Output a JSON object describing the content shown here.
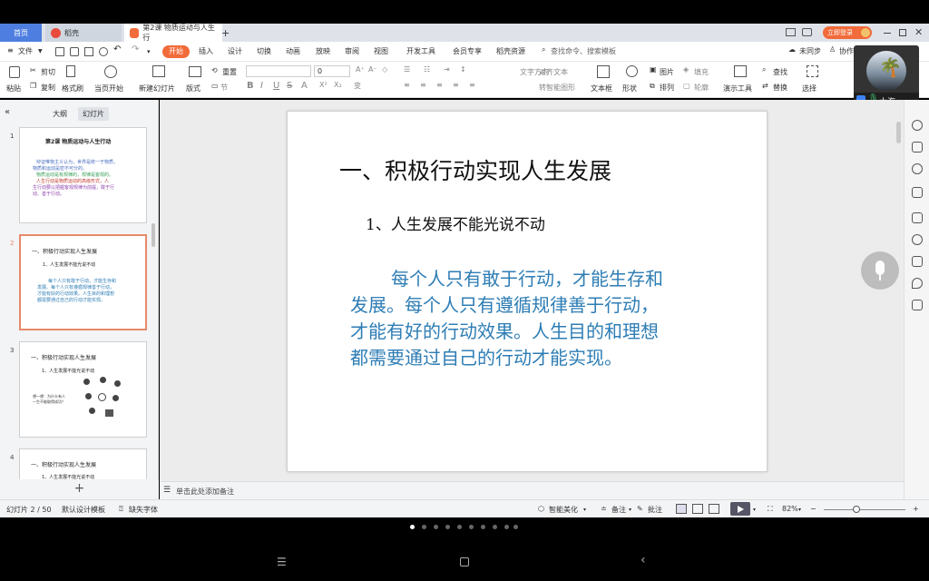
{
  "tabs": {
    "home": "首页",
    "daoke": "稻壳",
    "doc": "第2课 物质运动与人生行",
    "add": "+"
  },
  "login": {
    "label": "立即登录"
  },
  "menu": {
    "file": "文件",
    "start": "开始",
    "items": [
      "插入",
      "设计",
      "切换",
      "动画",
      "放映",
      "审阅",
      "视图",
      "开发工具",
      "会员专享",
      "稻壳资源"
    ],
    "search_placeholder": "查找命令、搜索模板",
    "sync": "未同步",
    "collab": "协作"
  },
  "ribbon": {
    "paste": "粘贴",
    "cut": "剪切",
    "copy": "复制",
    "format_painter": "格式刷",
    "from_current": "当页开始",
    "new_slide": "新建幻灯片",
    "layout": "版式",
    "section": "节",
    "reset": "重置",
    "font_size": "0",
    "text_direction": "文字方向",
    "align_text": "对齐文本",
    "smart_graphic": "转智能图形",
    "textbox": "文本框",
    "shape": "形状",
    "picture": "图片",
    "fill": "填充",
    "arrange": "排列",
    "outline": "轮廓",
    "present_tools": "演示工具",
    "find": "查找",
    "replace": "替换",
    "select": "选择"
  },
  "user": {
    "name": "大海"
  },
  "left_panel": {
    "tab_outline": "大纲",
    "tab_slides": "幻灯片",
    "add": "+"
  },
  "thumbs": [
    {
      "num": "1",
      "title": "第2课 物质运动与人生行动",
      "lines": [
        "辩证唯物主义认为，世界是统一于物质，",
        "物质和运动是密不可分的。",
        "物质运动是有规律的，规律是客观的。",
        "人生行动是物质运动的高级形式，人",
        "生行动要以把握客观规律为前提，敢于行",
        "动、善于行动。"
      ]
    },
    {
      "num": "2",
      "title": "一、积极行动实现人生发展",
      "sub": "1、人生发展不能光说不动",
      "lines": [
        "每个人只有敢于行动，才能生存和",
        "发展。每个人只有遵循规律善于行动，",
        "才能有好的行动效果。人生目的和理想",
        "都需要通过自己的行动才能实现。"
      ]
    },
    {
      "num": "3",
      "title": "一、积极行动实现人生发展",
      "sub": "1、人生发展不能光说不动",
      "lines": [
        "想一想：为什么有人",
        "一生不能取得成功？"
      ]
    },
    {
      "num": "4",
      "title": "一、积极行动实现人生发展",
      "sub": "1、人生发展不能光说不动"
    }
  ],
  "slide": {
    "title": "一、积极行动实现人生发展",
    "subtitle": "1、人生发展不能光说不动",
    "body": [
      "每个人只有敢于行动，才能生存和",
      "发展。每个人只有遵循规律善于行动，",
      "才能有好的行动效果。人生目的和理想",
      "都需要通过自己的行动才能实现。"
    ]
  },
  "notes": {
    "placeholder": "单击此处添加备注"
  },
  "status": {
    "slide_count": "幻灯片 2 / 50",
    "template": "默认设计模板",
    "missing_font": "缺失字体",
    "beautify": "智能美化",
    "note": "备注",
    "comment": "批注",
    "zoom": "82%"
  },
  "colors": {
    "accent": "#f26b3a",
    "body_text": "#2e7db5",
    "tab_home": "#4e7fe0"
  }
}
